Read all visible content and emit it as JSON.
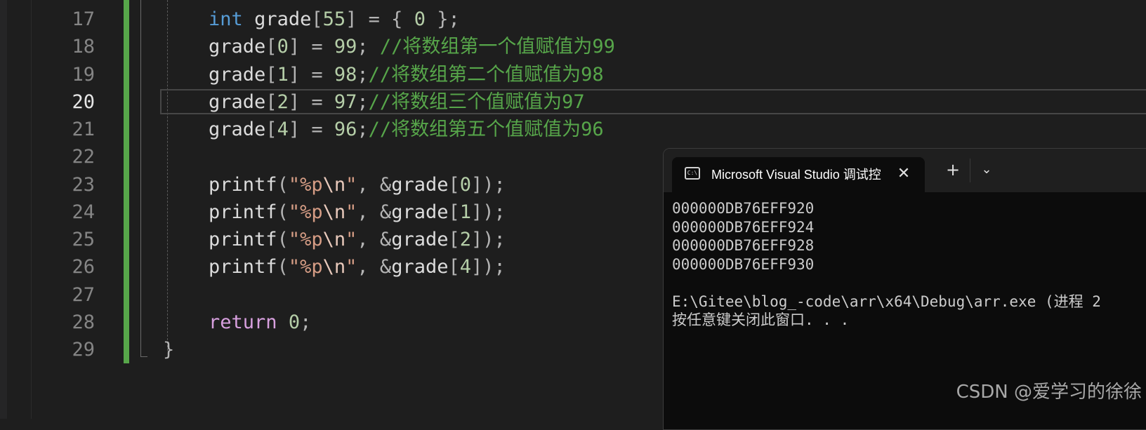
{
  "editor": {
    "line_numbers": [
      "17",
      "18",
      "19",
      "20",
      "21",
      "22",
      "23",
      "24",
      "25",
      "26",
      "27",
      "28",
      "29"
    ],
    "active_line": "20",
    "lines": [
      {
        "indent": "    ",
        "tokens": [
          {
            "t": "int",
            "c": "kw"
          },
          {
            "t": " grade",
            "c": ""
          },
          {
            "t": "[",
            "c": "punc"
          },
          {
            "t": "55",
            "c": "num"
          },
          {
            "t": "] = { ",
            "c": "punc"
          },
          {
            "t": "0",
            "c": "num"
          },
          {
            "t": " };",
            "c": "punc"
          }
        ]
      },
      {
        "indent": "    ",
        "tokens": [
          {
            "t": "grade",
            "c": ""
          },
          {
            "t": "[",
            "c": "punc"
          },
          {
            "t": "0",
            "c": "num"
          },
          {
            "t": "] = ",
            "c": "punc"
          },
          {
            "t": "99",
            "c": "num"
          },
          {
            "t": "; ",
            "c": "punc"
          },
          {
            "t": "//将数组第一个值赋值为99",
            "c": "cmt"
          }
        ]
      },
      {
        "indent": "    ",
        "tokens": [
          {
            "t": "grade",
            "c": ""
          },
          {
            "t": "[",
            "c": "punc"
          },
          {
            "t": "1",
            "c": "num"
          },
          {
            "t": "] = ",
            "c": "punc"
          },
          {
            "t": "98",
            "c": "num"
          },
          {
            "t": ";",
            "c": "punc"
          },
          {
            "t": "//将数组第二个值赋值为98",
            "c": "cmt"
          }
        ]
      },
      {
        "indent": "    ",
        "tokens": [
          {
            "t": "grade",
            "c": ""
          },
          {
            "t": "[",
            "c": "punc"
          },
          {
            "t": "2",
            "c": "num"
          },
          {
            "t": "] = ",
            "c": "punc"
          },
          {
            "t": "97",
            "c": "num"
          },
          {
            "t": ";",
            "c": "punc"
          },
          {
            "t": "//将数组三个值赋值为97",
            "c": "cmt"
          }
        ]
      },
      {
        "indent": "    ",
        "tokens": [
          {
            "t": "grade",
            "c": ""
          },
          {
            "t": "[",
            "c": "punc"
          },
          {
            "t": "4",
            "c": "num"
          },
          {
            "t": "] = ",
            "c": "punc"
          },
          {
            "t": "96",
            "c": "num"
          },
          {
            "t": ";",
            "c": "punc"
          },
          {
            "t": "//将数组第五个值赋值为96",
            "c": "cmt"
          }
        ]
      },
      {
        "indent": "",
        "tokens": []
      },
      {
        "indent": "    ",
        "tokens": [
          {
            "t": "printf",
            "c": ""
          },
          {
            "t": "(",
            "c": "punc"
          },
          {
            "t": "\"%p",
            "c": "str"
          },
          {
            "t": "\\n",
            "c": "esc"
          },
          {
            "t": "\"",
            "c": "str"
          },
          {
            "t": ", &",
            "c": "punc"
          },
          {
            "t": "grade",
            "c": ""
          },
          {
            "t": "[",
            "c": "punc"
          },
          {
            "t": "0",
            "c": "num"
          },
          {
            "t": "]);",
            "c": "punc"
          }
        ]
      },
      {
        "indent": "    ",
        "tokens": [
          {
            "t": "printf",
            "c": ""
          },
          {
            "t": "(",
            "c": "punc"
          },
          {
            "t": "\"%p",
            "c": "str"
          },
          {
            "t": "\\n",
            "c": "esc"
          },
          {
            "t": "\"",
            "c": "str"
          },
          {
            "t": ", &",
            "c": "punc"
          },
          {
            "t": "grade",
            "c": ""
          },
          {
            "t": "[",
            "c": "punc"
          },
          {
            "t": "1",
            "c": "num"
          },
          {
            "t": "]);",
            "c": "punc"
          }
        ]
      },
      {
        "indent": "    ",
        "tokens": [
          {
            "t": "printf",
            "c": ""
          },
          {
            "t": "(",
            "c": "punc"
          },
          {
            "t": "\"%p",
            "c": "str"
          },
          {
            "t": "\\n",
            "c": "esc"
          },
          {
            "t": "\"",
            "c": "str"
          },
          {
            "t": ", &",
            "c": "punc"
          },
          {
            "t": "grade",
            "c": ""
          },
          {
            "t": "[",
            "c": "punc"
          },
          {
            "t": "2",
            "c": "num"
          },
          {
            "t": "]);",
            "c": "punc"
          }
        ]
      },
      {
        "indent": "    ",
        "tokens": [
          {
            "t": "printf",
            "c": ""
          },
          {
            "t": "(",
            "c": "punc"
          },
          {
            "t": "\"%p",
            "c": "str"
          },
          {
            "t": "\\n",
            "c": "esc"
          },
          {
            "t": "\"",
            "c": "str"
          },
          {
            "t": ", &",
            "c": "punc"
          },
          {
            "t": "grade",
            "c": ""
          },
          {
            "t": "[",
            "c": "punc"
          },
          {
            "t": "4",
            "c": "num"
          },
          {
            "t": "]);",
            "c": "punc"
          }
        ]
      },
      {
        "indent": "",
        "tokens": []
      },
      {
        "indent": "    ",
        "tokens": [
          {
            "t": "return",
            "c": "kw2"
          },
          {
            "t": " ",
            "c": ""
          },
          {
            "t": "0",
            "c": "num"
          },
          {
            "t": ";",
            "c": "punc"
          }
        ]
      },
      {
        "indent": "",
        "tokens": [
          {
            "t": "}",
            "c": "punc"
          }
        ]
      }
    ]
  },
  "console": {
    "tab_icon": "C:\\",
    "tab_title": "Microsoft Visual Studio 调试控",
    "close_glyph": "✕",
    "new_tab_glyph": "+",
    "dropdown_glyph": "⌄",
    "output_lines": [
      "000000DB76EFF920",
      "000000DB76EFF924",
      "000000DB76EFF928",
      "000000DB76EFF930",
      "",
      "E:\\Gitee\\blog_-code\\arr\\x64\\Debug\\arr.exe (进程 2",
      "按任意键关闭此窗口. . ."
    ]
  },
  "watermark": "CSDN @爱学习的徐徐",
  "colors": {
    "background": "#1e1e1e",
    "keyword": "#569cd6",
    "comment": "#57a64a",
    "number": "#b5cea8",
    "string": "#d69d85"
  }
}
